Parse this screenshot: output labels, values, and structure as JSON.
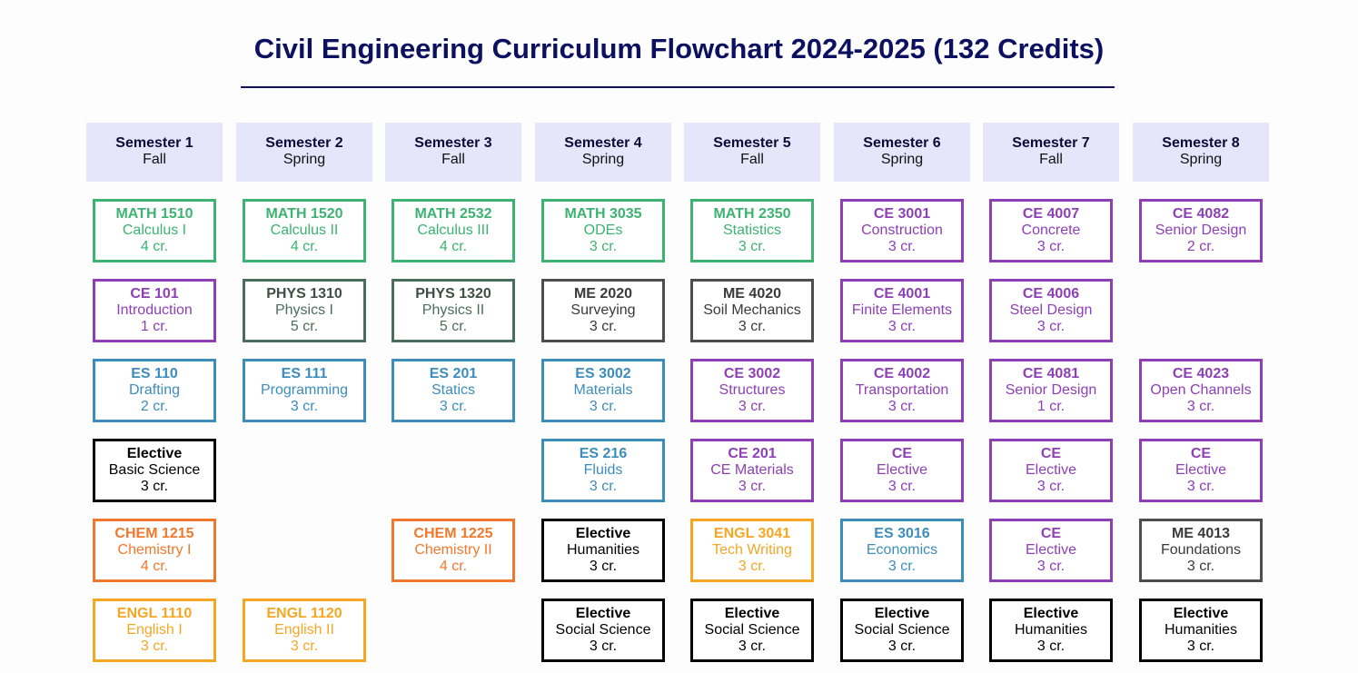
{
  "title": "Civil Engineering Curriculum Flowchart 2024-2025 (132 Credits)",
  "colors": {
    "title": "#0b1061",
    "header_bg": "#e6e6fa",
    "math": "#3cb371",
    "ce": "#8e3fb5",
    "es": "#3c8dbc",
    "elective": "#b83c62",
    "chem": "#f0782d",
    "engl": "#f5a623",
    "phys": "#4a6e5c",
    "me": "#4d4d4d"
  },
  "semesters": [
    {
      "name": "Semester 1",
      "term": "Fall"
    },
    {
      "name": "Semester 2",
      "term": "Spring"
    },
    {
      "name": "Semester 3",
      "term": "Fall"
    },
    {
      "name": "Semester 4",
      "term": "Spring"
    },
    {
      "name": "Semester 5",
      "term": "Fall"
    },
    {
      "name": "Semester 6",
      "term": "Spring"
    },
    {
      "name": "Semester 7",
      "term": "Fall"
    },
    {
      "name": "Semester 8",
      "term": "Spring"
    }
  ],
  "courses": [
    {
      "semester": 1,
      "row": 1,
      "category": "math",
      "code": "MATH 1510",
      "name": "Calculus I",
      "credits": "4 cr."
    },
    {
      "semester": 1,
      "row": 2,
      "category": "ce",
      "code": "CE 101",
      "name": "Introduction",
      "credits": "1 cr."
    },
    {
      "semester": 1,
      "row": 3,
      "category": "es",
      "code": "ES 110",
      "name": "Drafting",
      "credits": "2 cr."
    },
    {
      "semester": 1,
      "row": 4,
      "category": "elective",
      "code": "Elective",
      "name": "Basic Science",
      "credits": "3 cr."
    },
    {
      "semester": 1,
      "row": 5,
      "category": "chem",
      "code": "CHEM 1215",
      "name": "Chemistry I",
      "credits": "4 cr."
    },
    {
      "semester": 1,
      "row": 6,
      "category": "engl",
      "code": "ENGL 1110",
      "name": "English I",
      "credits": "3 cr."
    },
    {
      "semester": 2,
      "row": 1,
      "category": "math",
      "code": "MATH 1520",
      "name": "Calculus II",
      "credits": "4 cr."
    },
    {
      "semester": 2,
      "row": 2,
      "category": "phys",
      "code": "PHYS 1310",
      "name": "Physics I",
      "credits": "5 cr."
    },
    {
      "semester": 2,
      "row": 3,
      "category": "es",
      "code": "ES 111",
      "name": "Programming",
      "credits": "3 cr."
    },
    {
      "semester": 2,
      "row": 6,
      "category": "engl",
      "code": "ENGL 1120",
      "name": "English II",
      "credits": "3 cr."
    },
    {
      "semester": 3,
      "row": 1,
      "category": "math",
      "code": "MATH 2532",
      "name": "Calculus III",
      "credits": "4 cr."
    },
    {
      "semester": 3,
      "row": 2,
      "category": "phys",
      "code": "PHYS 1320",
      "name": "Physics II",
      "credits": "5 cr."
    },
    {
      "semester": 3,
      "row": 3,
      "category": "es",
      "code": "ES 201",
      "name": "Statics",
      "credits": "3 cr."
    },
    {
      "semester": 3,
      "row": 5,
      "category": "chem",
      "code": "CHEM 1225",
      "name": "Chemistry II",
      "credits": "4 cr."
    },
    {
      "semester": 4,
      "row": 1,
      "category": "math",
      "code": "MATH 3035",
      "name": "ODEs",
      "credits": "3 cr."
    },
    {
      "semester": 4,
      "row": 2,
      "category": "me",
      "code": "ME 2020",
      "name": "Surveying",
      "credits": "3 cr."
    },
    {
      "semester": 4,
      "row": 3,
      "category": "es",
      "code": "ES 3002",
      "name": "Materials",
      "credits": "3 cr."
    },
    {
      "semester": 4,
      "row": 4,
      "category": "es",
      "code": "ES 216",
      "name": "Fluids",
      "credits": "3 cr."
    },
    {
      "semester": 4,
      "row": 5,
      "category": "elective",
      "code": "Elective",
      "name": "Humanities",
      "credits": "3 cr."
    },
    {
      "semester": 4,
      "row": 6,
      "category": "elective",
      "code": "Elective",
      "name": "Social Science",
      "credits": "3 cr."
    },
    {
      "semester": 5,
      "row": 1,
      "category": "math",
      "code": "MATH 2350",
      "name": "Statistics",
      "credits": "3 cr."
    },
    {
      "semester": 5,
      "row": 2,
      "category": "me",
      "code": "ME 4020",
      "name": "Soil Mechanics",
      "credits": "3 cr."
    },
    {
      "semester": 5,
      "row": 3,
      "category": "ce",
      "code": "CE 3002",
      "name": "Structures",
      "credits": "3 cr."
    },
    {
      "semester": 5,
      "row": 4,
      "category": "ce",
      "code": "CE 201",
      "name": "CE Materials",
      "credits": "3 cr."
    },
    {
      "semester": 5,
      "row": 5,
      "category": "engl",
      "code": "ENGL 3041",
      "name": "Tech Writing",
      "credits": "3 cr."
    },
    {
      "semester": 5,
      "row": 6,
      "category": "elective",
      "code": "Elective",
      "name": "Social Science",
      "credits": "3 cr."
    },
    {
      "semester": 6,
      "row": 1,
      "category": "ce",
      "code": "CE 3001",
      "name": "Construction",
      "credits": "3 cr."
    },
    {
      "semester": 6,
      "row": 2,
      "category": "ce",
      "code": "CE 4001",
      "name": "Finite Elements",
      "credits": "3 cr."
    },
    {
      "semester": 6,
      "row": 3,
      "category": "ce",
      "code": "CE 4002",
      "name": "Transportation",
      "credits": "3 cr."
    },
    {
      "semester": 6,
      "row": 4,
      "category": "ce",
      "code": "CE",
      "name": "Elective",
      "credits": "3 cr."
    },
    {
      "semester": 6,
      "row": 5,
      "category": "es",
      "code": "ES 3016",
      "name": "Economics",
      "credits": "3 cr."
    },
    {
      "semester": 6,
      "row": 6,
      "category": "elective",
      "code": "Elective",
      "name": "Social Science",
      "credits": "3 cr."
    },
    {
      "semester": 7,
      "row": 1,
      "category": "ce",
      "code": "CE 4007",
      "name": "Concrete",
      "credits": "3 cr."
    },
    {
      "semester": 7,
      "row": 2,
      "category": "ce",
      "code": "CE 4006",
      "name": "Steel Design",
      "credits": "3 cr."
    },
    {
      "semester": 7,
      "row": 3,
      "category": "ce",
      "code": "CE 4081",
      "name": "Senior Design",
      "credits": "1 cr."
    },
    {
      "semester": 7,
      "row": 4,
      "category": "ce",
      "code": "CE",
      "name": "Elective",
      "credits": "3 cr."
    },
    {
      "semester": 7,
      "row": 5,
      "category": "ce",
      "code": "CE",
      "name": "Elective",
      "credits": "3 cr."
    },
    {
      "semester": 7,
      "row": 6,
      "category": "elective",
      "code": "Elective",
      "name": "Humanities",
      "credits": "3 cr."
    },
    {
      "semester": 8,
      "row": 1,
      "category": "ce",
      "code": "CE 4082",
      "name": "Senior Design",
      "credits": "2 cr."
    },
    {
      "semester": 8,
      "row": 3,
      "category": "ce",
      "code": "CE 4023",
      "name": "Open Channels",
      "credits": "3 cr."
    },
    {
      "semester": 8,
      "row": 4,
      "category": "ce",
      "code": "CE",
      "name": "Elective",
      "credits": "3 cr."
    },
    {
      "semester": 8,
      "row": 5,
      "category": "me",
      "code": "ME 4013",
      "name": "Foundations",
      "credits": "3 cr."
    },
    {
      "semester": 8,
      "row": 6,
      "category": "elective",
      "code": "Elective",
      "name": "Humanities",
      "credits": "3 cr."
    }
  ]
}
